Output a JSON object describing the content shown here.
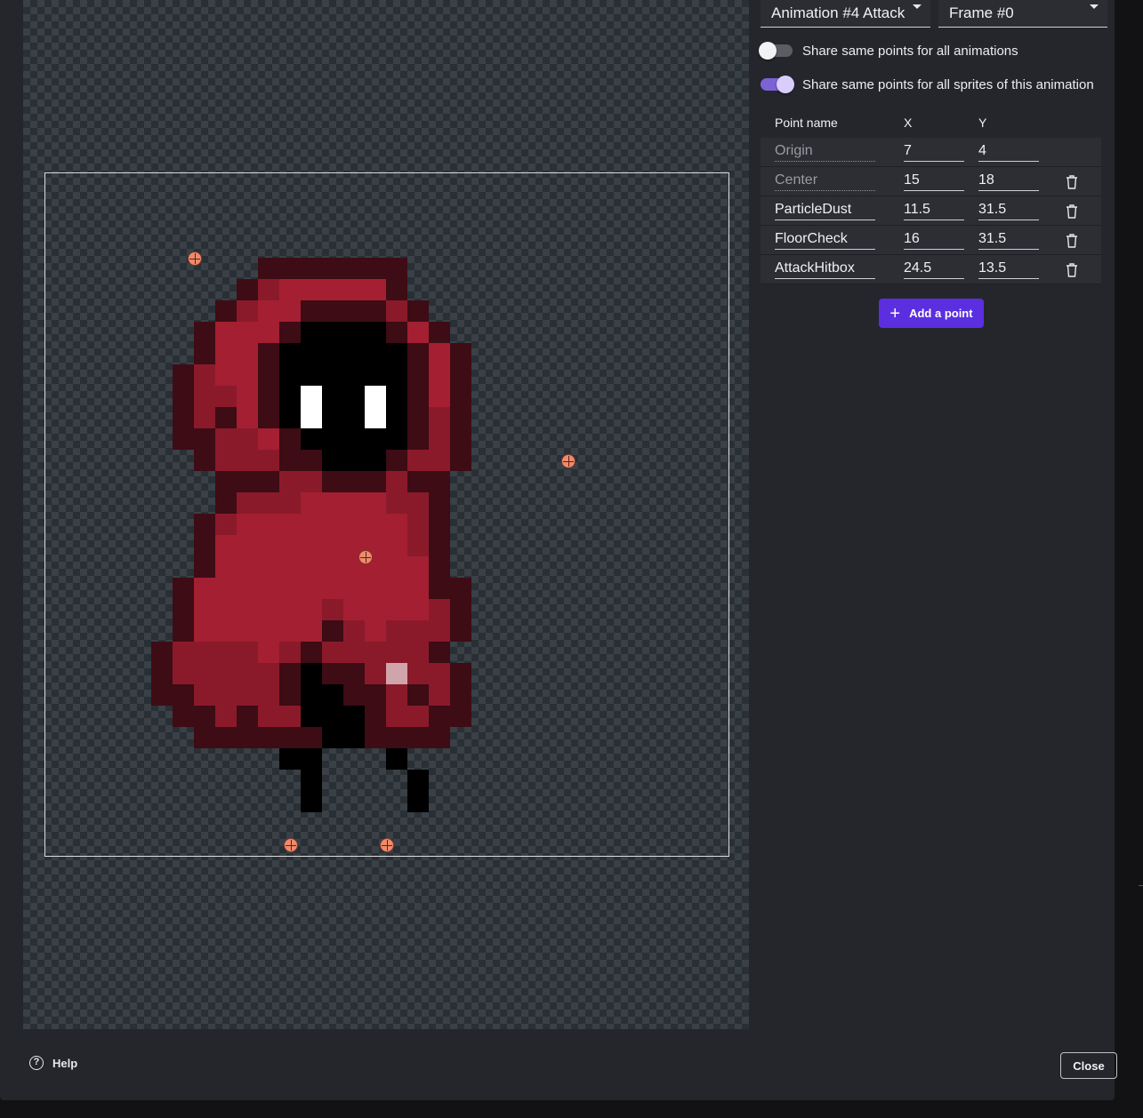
{
  "header": {
    "animation_select": "Animation #4 Attack",
    "frame_select": "Frame #0"
  },
  "toggles": [
    {
      "label": "Share same points for all animations",
      "on": false
    },
    {
      "label": "Share same points for all sprites of this animation",
      "on": true
    }
  ],
  "table": {
    "headers": {
      "name": "Point name",
      "x": "X",
      "y": "Y"
    },
    "rows": [
      {
        "name": "Origin",
        "x": "7",
        "y": "4",
        "locked": true,
        "deletable": false
      },
      {
        "name": "Center",
        "x": "15",
        "y": "18",
        "locked": true,
        "deletable": true
      },
      {
        "name": "ParticleDust",
        "x": "11.5",
        "y": "31.5",
        "locked": false,
        "deletable": true
      },
      {
        "name": "FloorCheck",
        "x": "16",
        "y": "31.5",
        "locked": false,
        "deletable": true
      },
      {
        "name": "AttackHitbox",
        "x": "24.5",
        "y": "13.5",
        "locked": false,
        "deletable": true
      }
    ]
  },
  "buttons": {
    "add_point": "Add a point",
    "help": "Help",
    "close": "Close"
  },
  "icons": {
    "help": "help-circle-icon",
    "add": "plus-icon",
    "delete": "trash-icon",
    "dropdown": "caret-down-icon"
  },
  "colors": {
    "accent": "#5b2ee0",
    "toggle_on": "#7b63d6",
    "point_marker": "#f08a6c"
  }
}
